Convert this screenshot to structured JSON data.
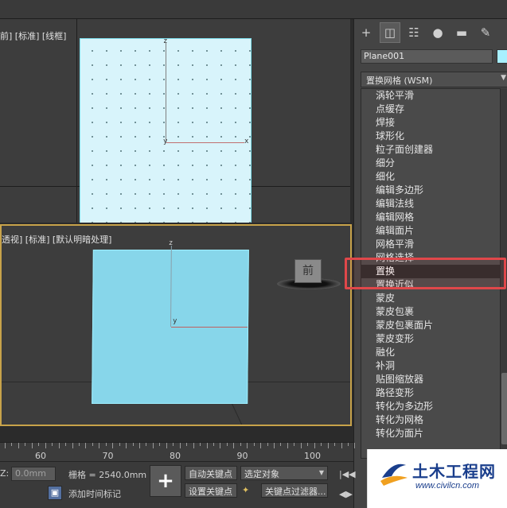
{
  "viewports": {
    "top": {
      "label": "前] [标准] [线框]",
      "axis_z": "z",
      "axis_x": "x",
      "axis_y": "y"
    },
    "perspective": {
      "label": "透视] [标准] [默认明暗处理]",
      "axis_z": "z",
      "axis_y": "y",
      "nav_cube_label": "前"
    }
  },
  "command_panel": {
    "tabs": [
      {
        "icon": "plus-icon",
        "glyph": "+"
      },
      {
        "icon": "modify-icon",
        "glyph": "◫"
      },
      {
        "icon": "hierarchy-icon",
        "glyph": "☷"
      },
      {
        "icon": "motion-icon",
        "glyph": "●"
      },
      {
        "icon": "display-icon",
        "glyph": "▬"
      },
      {
        "icon": "utilities-icon",
        "glyph": "✎"
      }
    ],
    "object_name": "Plane001",
    "object_color": "#a8f0ff",
    "modifier_dropdown": "置换网格 (WSM)",
    "modifier_list": [
      "涡轮平滑",
      "点缓存",
      "焊接",
      "球形化",
      "粒子面创建器",
      "细分",
      "细化",
      "编辑多边形",
      "编辑法线",
      "编辑网格",
      "编辑面片",
      "网格平滑",
      "网格选择",
      "置换",
      "置换近似",
      "蒙皮",
      "蒙皮包裹",
      "蒙皮包裹面片",
      "蒙皮变形",
      "融化",
      "补洞",
      "贴图缩放器",
      "路径变形",
      "转化为多边形",
      "转化为网格",
      "转化为面片"
    ],
    "selected_modifier": "置换",
    "highlight_color": "#e0474a"
  },
  "timeline": {
    "labels": [
      "60",
      "70",
      "80",
      "90",
      "100"
    ]
  },
  "status_bar": {
    "z_label": "Z:",
    "z_value": "0.0mm",
    "grid_label": "栅格 = 2540.0mm",
    "add_time_tag": "添加时间标记",
    "auto_key": "自动关键点",
    "set_key": "设置关键点",
    "selection_dropdown": "选定对象",
    "key_filters": "关键点过滤器...",
    "key_plus": "+"
  },
  "watermark": {
    "title": "土木工程网",
    "url": "www.civilcn.com"
  }
}
